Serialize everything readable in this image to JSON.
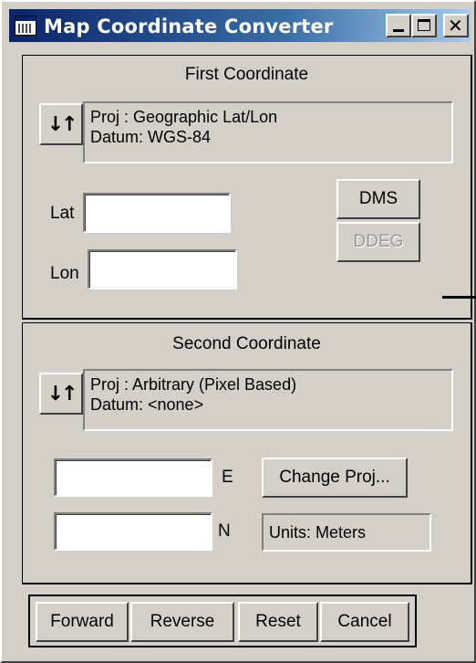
{
  "window": {
    "title": "Map Coordinate Converter"
  },
  "first": {
    "title": "First Coordinate",
    "proj_line": "Proj : Geographic Lat/Lon",
    "datum_line": "Datum: WGS-84",
    "lat_label": "Lat",
    "lon_label": "Lon",
    "lat_value": "",
    "lon_value": "",
    "dms_label": "DMS",
    "ddeg_label": "DDEG"
  },
  "second": {
    "title": "Second Coordinate",
    "proj_line": "Proj : Arbitrary (Pixel Based)",
    "datum_line": "Datum: <none>",
    "e_label": "E",
    "n_label": "N",
    "e_value": "",
    "n_value": "",
    "change_proj_label": "Change Proj...",
    "units_text": "Units: Meters"
  },
  "actions": {
    "forward": "Forward",
    "reverse": "Reverse",
    "reset": "Reset",
    "cancel": "Cancel"
  },
  "icons": {
    "swap": "↓↑",
    "close": "✕"
  }
}
